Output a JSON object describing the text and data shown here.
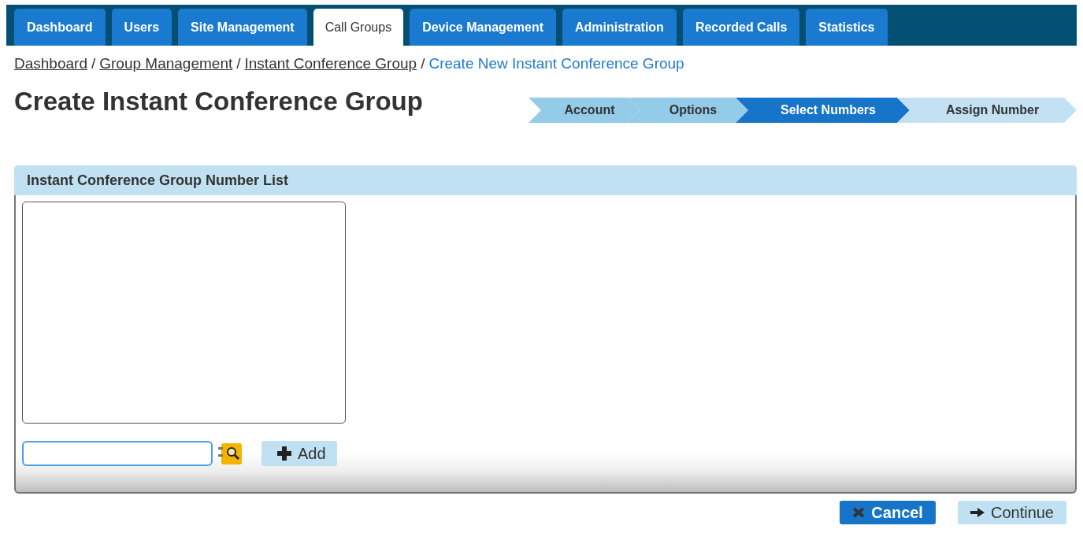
{
  "nav_tabs": [
    {
      "label": "Dashboard",
      "selected": false
    },
    {
      "label": "Users",
      "selected": false
    },
    {
      "label": "Site Management",
      "selected": false
    },
    {
      "label": "Call Groups",
      "selected": true
    },
    {
      "label": "Device Management",
      "selected": false
    },
    {
      "label": "Administration",
      "selected": false
    },
    {
      "label": "Recorded Calls",
      "selected": false
    },
    {
      "label": "Statistics",
      "selected": false
    }
  ],
  "breadcrumb": [
    {
      "label": "Dashboard",
      "kind": "link"
    },
    {
      "label": "Group Management",
      "kind": "link"
    },
    {
      "label": "Instant Conference Group",
      "kind": "link"
    },
    {
      "label": "Create New Instant Conference Group",
      "kind": "current"
    }
  ],
  "separator": "/",
  "page_title": "Create Instant Conference Group",
  "steps": [
    {
      "label": "Account",
      "selected": false,
      "completed": true
    },
    {
      "label": "Options",
      "selected": false,
      "completed": true
    },
    {
      "label": "Select Numbers",
      "selected": true,
      "completed": false
    },
    {
      "label": "Assign Number",
      "selected": false,
      "completed": false
    }
  ],
  "panel": {
    "title": "Instant Conference Group Number List",
    "add_button": "Add"
  },
  "buttons": [
    {
      "label": "Cancel",
      "kind": "primary"
    },
    {
      "label": "Continue",
      "kind": "secondary"
    }
  ]
}
